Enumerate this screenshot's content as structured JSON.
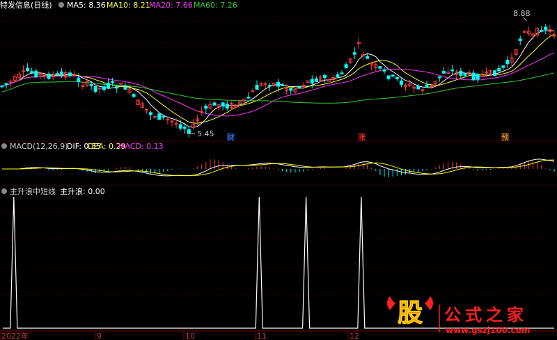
{
  "stock_name": "特发信息(日线)",
  "ma_legend": [
    {
      "label": "MA5: 8.36",
      "color": "#ffffff"
    },
    {
      "label": "MA10: 8.21",
      "color": "#ffff33"
    },
    {
      "label": "MA20: 7.66",
      "color": "#ff33ff"
    },
    {
      "label": "MA60: 7.26",
      "color": "#33cc33"
    }
  ],
  "price_high_label": "8.88",
  "price_low_label": "5.45",
  "event_tags": [
    {
      "text": "财",
      "color": "#4f86ff"
    },
    {
      "text": "涨",
      "color": "#ff4040"
    },
    {
      "text": "预",
      "color": "#ffa040"
    }
  ],
  "macd_legend": {
    "title": "MACD(12,26,9)",
    "dif": "DIF: 0.35",
    "dea": "DEA: 0.29",
    "macd": "MACD: 0.13"
  },
  "indicator_legend": {
    "title": "主升浪中短线",
    "value": "主升浪: 0.00"
  },
  "date_axis": [
    "2022年",
    "9",
    "10",
    "11",
    "12"
  ],
  "watermark": {
    "big_char": "股",
    "brand": "公式之家",
    "url": "www.gszj100.com"
  },
  "colors": {
    "up": "#ff3b3b",
    "down": "#00ffff",
    "grid": "#7a0000",
    "macd_dif": "#ffffff",
    "macd_dea": "#ffff00",
    "indicator": "#ffffff"
  },
  "chart_data": [
    {
      "type": "candlestick",
      "title": "特发信息(日线)",
      "y_range": [
        5.2,
        9.2
      ],
      "annotations": [
        {
          "text": "8.88",
          "value": 8.88,
          "kind": "high"
        },
        {
          "text": "5.45",
          "value": 5.45,
          "kind": "low"
        }
      ],
      "ma_series": [
        {
          "name": "MA5",
          "last": 8.36
        },
        {
          "name": "MA10",
          "last": 8.21
        },
        {
          "name": "MA20",
          "last": 7.66
        },
        {
          "name": "MA60",
          "last": 7.26
        }
      ]
    },
    {
      "type": "macd",
      "title": "MACD(12,26,9)",
      "dif": 0.35,
      "dea": 0.29,
      "macd": 0.13
    },
    {
      "type": "line",
      "title": "主升浪中短线",
      "series": [
        {
          "name": "主升浪",
          "last": 0.0
        }
      ],
      "ylim": [
        0,
        1
      ],
      "spikes_at_fraction_of_range": [
        0.02,
        0.465,
        0.55,
        0.65
      ],
      "spike_value": 1
    }
  ]
}
